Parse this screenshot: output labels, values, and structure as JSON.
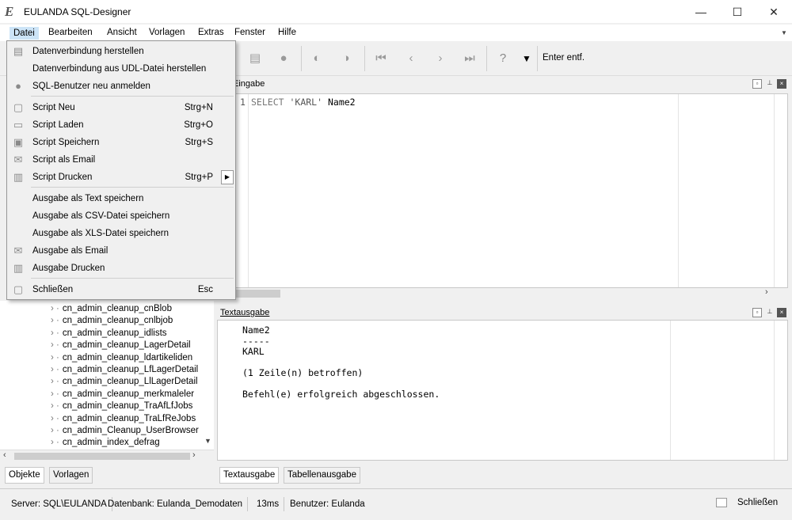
{
  "window": {
    "title": "EULANDA SQL-Designer",
    "logo_letter": "E",
    "minimize": "—",
    "maximize": "☐",
    "close": "✕"
  },
  "menubar": [
    "Datei",
    "Bearbeiten",
    "Ansicht",
    "Vorlagen",
    "Extras",
    "Fenster",
    "Hilfe"
  ],
  "toolbar": {
    "enter_label": "Enter entf."
  },
  "editor": {
    "title": "Eingabe",
    "line_number": "1",
    "code_keyword": "SELECT",
    "code_string": "'KARL'",
    "code_ident": "Name2"
  },
  "output": {
    "title": "Textausgabe",
    "lines": [
      "Name2",
      "-----",
      "KARL",
      "",
      "(1 Zeile(n) betroffen)",
      "",
      "Befehl(e) erfolgreich abgeschlossen."
    ]
  },
  "tree": {
    "items": [
      "cn_admin_cleanup_cnBlob",
      "cn_admin_cleanup_cnlbjob",
      "cn_admin_cleanup_idlists",
      "cn_admin_cleanup_LagerDetail",
      "cn_admin_cleanup_ldartikeliden",
      "cn_admin_cleanup_LfLagerDetail",
      "cn_admin_cleanup_LlLagerDetail",
      "cn_admin_cleanup_merkmaleler",
      "cn_admin_cleanup_TraAfLfJobs",
      "cn_admin_cleanup_TraLfReJobs",
      "cn_admin_Cleanup_UserBrowser",
      "cn_admin_index_defrag"
    ]
  },
  "left_tabs": [
    "Objekte",
    "Vorlagen"
  ],
  "right_tabs": [
    "Textausgabe",
    "Tabellenausgabe"
  ],
  "statusbar": {
    "server": "Server: SQL\\EULANDA",
    "database": "Datenbank: Eulanda_Demodaten",
    "time": "13ms",
    "user": "Benutzer: Eulanda",
    "close": "Schließen"
  },
  "datei_menu": {
    "items": [
      {
        "label": "Datenverbindung herstellen",
        "shortcut": "",
        "icon": "db-connect-icon"
      },
      {
        "label": "Datenverbindung aus UDL-Datei herstellen",
        "shortcut": "",
        "icon": ""
      },
      {
        "label": "SQL-Benutzer neu anmelden",
        "shortcut": "",
        "icon": "user-icon"
      },
      {
        "label": "Script Neu",
        "shortcut": "Strg+N",
        "icon": "new-file-icon"
      },
      {
        "label": "Script Laden",
        "shortcut": "Strg+O",
        "icon": "folder-open-icon"
      },
      {
        "label": "Script Speichern",
        "shortcut": "Strg+S",
        "icon": "save-icon"
      },
      {
        "label": "Script als Email",
        "shortcut": "",
        "icon": "email-icon"
      },
      {
        "label": "Script Drucken",
        "shortcut": "Strg+P",
        "icon": "print-icon"
      },
      {
        "label": "Ausgabe als Text speichern",
        "shortcut": "",
        "icon": ""
      },
      {
        "label": "Ausgabe als CSV-Datei speichern",
        "shortcut": "",
        "icon": ""
      },
      {
        "label": "Ausgabe als XLS-Datei speichern",
        "shortcut": "",
        "icon": ""
      },
      {
        "label": "Ausgabe als Email",
        "shortcut": "",
        "icon": "email-icon"
      },
      {
        "label": "Ausgabe Drucken",
        "shortcut": "",
        "icon": "print-icon"
      },
      {
        "label": "Schließen",
        "shortcut": "Esc",
        "icon": "close-window-icon"
      }
    ]
  }
}
